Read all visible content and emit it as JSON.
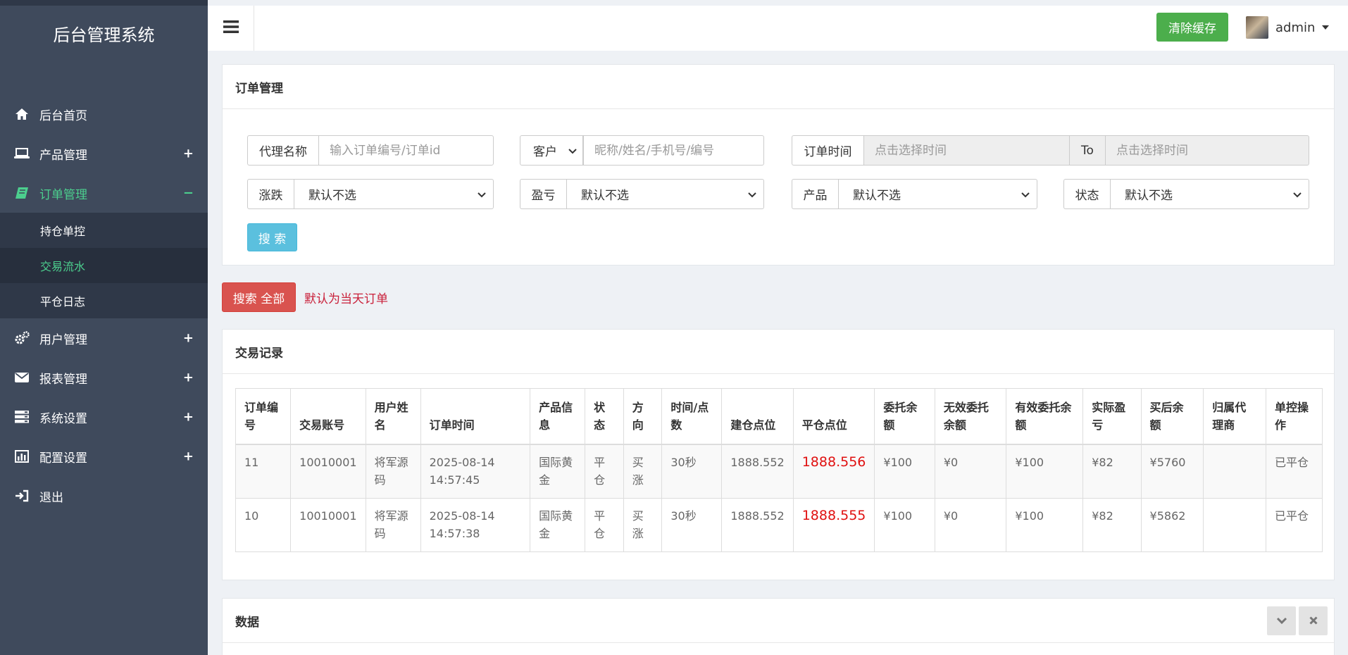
{
  "app": {
    "brand": "后台管理系统"
  },
  "sidebar": {
    "items": [
      {
        "label": "后台首页",
        "icon": "home-icon"
      },
      {
        "label": "产品管理",
        "icon": "laptop-icon",
        "toggle": "+"
      },
      {
        "label": "订单管理",
        "icon": "book-icon",
        "toggle": "−",
        "active": true,
        "children": [
          {
            "label": "持仓单控"
          },
          {
            "label": "交易流水",
            "active": true
          },
          {
            "label": "平仓日志"
          }
        ]
      },
      {
        "label": "用户管理",
        "icon": "gears-icon",
        "toggle": "+"
      },
      {
        "label": "报表管理",
        "icon": "envelope-icon",
        "toggle": "+"
      },
      {
        "label": "系统设置",
        "icon": "server-icon",
        "toggle": "+"
      },
      {
        "label": "配置设置",
        "icon": "bar-chart-icon",
        "toggle": "+"
      },
      {
        "label": "退出",
        "icon": "sign-out-icon"
      }
    ]
  },
  "header": {
    "clear_cache": "清除缓存",
    "username": "admin"
  },
  "order_panel": {
    "title": "订单管理",
    "agent": {
      "label": "代理名称",
      "placeholder": "输入订单编号/订单id"
    },
    "customer": {
      "select": "客户",
      "placeholder": "昵称/姓名/手机号/编号"
    },
    "order_time": {
      "label": "订单时间",
      "from_placeholder": "点击选择时间",
      "to": "To",
      "to_placeholder": "点击选择时间"
    },
    "rise_fall": {
      "label": "涨跌",
      "value": "默认不选"
    },
    "profit_loss": {
      "label": "盈亏",
      "value": "默认不选"
    },
    "product": {
      "label": "产品",
      "value": "默认不选"
    },
    "status": {
      "label": "状态",
      "value": "默认不选"
    },
    "search_button": "搜 索"
  },
  "search_all": {
    "button": "搜索 全部",
    "hint": "默认为当天订单"
  },
  "records": {
    "title": "交易记录",
    "columns": [
      "订单编号",
      "交易账号",
      "用户姓名",
      "订单时间",
      "产品信息",
      "状态",
      "方向",
      "时间/点数",
      "建仓点位",
      "平仓点位",
      "委托余额",
      "无效委托余额",
      "有效委托余额",
      "实际盈亏",
      "买后余额",
      "归属代理商",
      "单控操作"
    ],
    "rows": [
      [
        "11",
        "10010001",
        "将军源码",
        "2025-08-14 14:57:45",
        "国际黄金",
        "平仓",
        "买涨",
        "30秒",
        "1888.552",
        "1888.556",
        "¥100",
        "¥0",
        "¥100",
        "¥82",
        "¥5760",
        "",
        "已平仓"
      ],
      [
        "10",
        "10010001",
        "将军源码",
        "2025-08-14 14:57:38",
        "国际黄金",
        "平仓",
        "买涨",
        "30秒",
        "1888.552",
        "1888.555",
        "¥100",
        "¥0",
        "¥100",
        "¥82",
        "¥5862",
        "",
        "已平仓"
      ]
    ]
  },
  "data_panel": {
    "title": "数据"
  },
  "colors": {
    "sidebar": "#3f4a5c",
    "active": "#4ccf8e",
    "success": "#4cae4c",
    "info": "#5bc0de",
    "danger": "#d9534f",
    "price_red": "#e01010"
  }
}
